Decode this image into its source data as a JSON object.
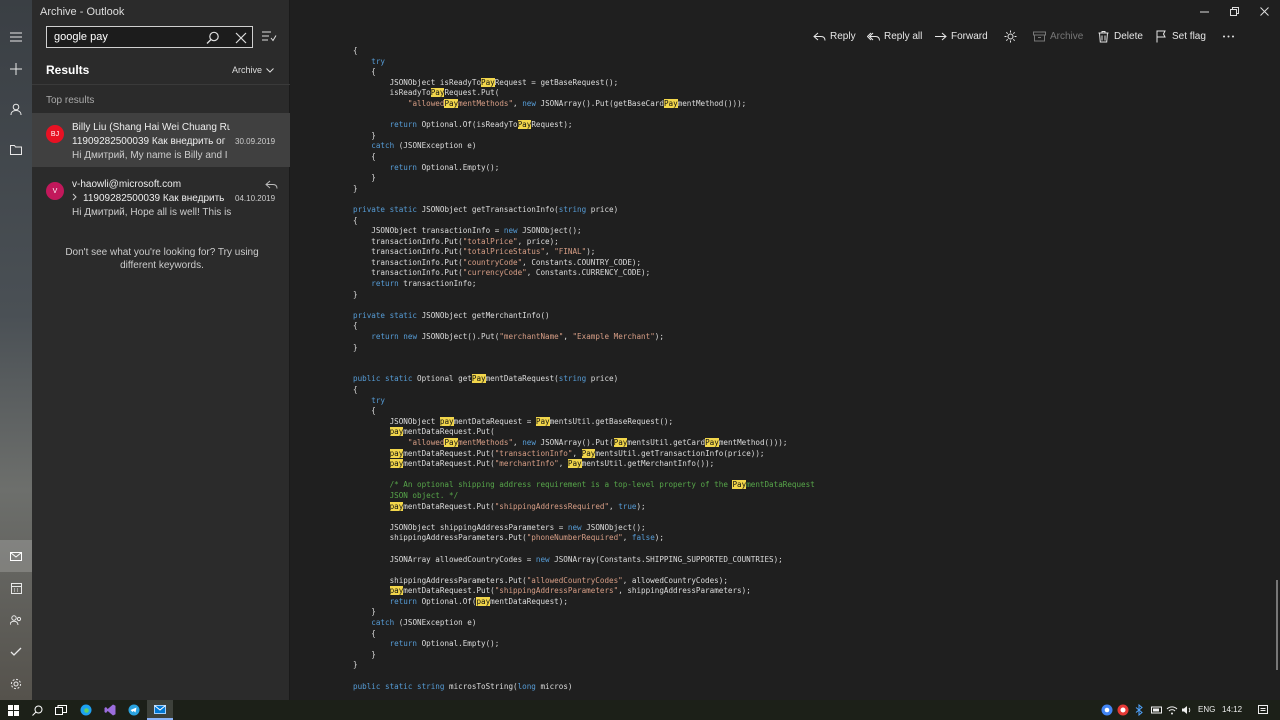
{
  "window": {
    "title": "Archive - Outlook"
  },
  "search": {
    "value": "google pay",
    "placeholder": "Search"
  },
  "list": {
    "title": "Results",
    "folder": "Archive",
    "section": "Top results",
    "empty_hint": "Don't see what you're looking for?  Try using different keywords.",
    "messages": [
      {
        "initials": "BJ",
        "avatar_color": "#e81123",
        "from": "Billy Liu (Shang Hai Wei Chuang Rua",
        "subject": "11909282500039 Как внедрить ог",
        "date": "30.09.2019",
        "preview": "Hi Дмитрий, My name is Billy and I"
      },
      {
        "initials": "V",
        "avatar_color": "#c2185b",
        "from": "v-haowli@microsoft.com",
        "subject": "11909282500039 Как внедрить",
        "date": "04.10.2019",
        "preview": "Hi Дмитрий, Hope all is well! This is"
      }
    ]
  },
  "toolbar": {
    "reply": "Reply",
    "reply_all": "Reply all",
    "forward": "Forward",
    "archive": "Archive",
    "delete": "Delete",
    "set_flag": "Set flag"
  },
  "code_lines": [
    [
      [
        "",
        "{"
      ]
    ],
    [
      [
        "kw",
        "    try"
      ]
    ],
    [
      [
        "",
        "    {"
      ]
    ],
    [
      [
        "",
        "        JSONObject isReadyTo"
      ],
      [
        "hl",
        "Pay"
      ],
      [
        "",
        "Request = getBaseRequest();"
      ]
    ],
    [
      [
        "",
        "        isReadyTo"
      ],
      [
        "hl",
        "Pay"
      ],
      [
        "",
        "Request.Put("
      ]
    ],
    [
      [
        "",
        "            "
      ],
      [
        "str",
        "\"allowed"
      ],
      [
        "hl",
        "Pay"
      ],
      [
        "str",
        "mentMethods\""
      ],
      [
        "",
        ", "
      ],
      [
        "kw",
        "new"
      ],
      [
        "",
        " JSONArray().Put(getBaseCard"
      ],
      [
        "hl",
        "Pay"
      ],
      [
        "",
        "mentMethod()));"
      ]
    ],
    [
      [
        "",
        ""
      ]
    ],
    [
      [
        "",
        "        "
      ],
      [
        "kw",
        "return"
      ],
      [
        "",
        " Optional.Of(isReadyTo"
      ],
      [
        "hl",
        "Pay"
      ],
      [
        "",
        "Request);"
      ]
    ],
    [
      [
        "",
        "    }"
      ]
    ],
    [
      [
        "kw",
        "    catch"
      ],
      [
        "",
        " (JSONException e)"
      ]
    ],
    [
      [
        "",
        "    {"
      ]
    ],
    [
      [
        "",
        "        "
      ],
      [
        "kw",
        "return"
      ],
      [
        "",
        " Optional.Empty();"
      ]
    ],
    [
      [
        "",
        "    }"
      ]
    ],
    [
      [
        "",
        "}"
      ]
    ],
    [
      [
        "",
        ""
      ]
    ],
    [
      [
        "kw",
        "private static"
      ],
      [
        "",
        " JSONObject getTransactionInfo("
      ],
      [
        "kw",
        "string"
      ],
      [
        "",
        " price)"
      ]
    ],
    [
      [
        "",
        "{"
      ]
    ],
    [
      [
        "",
        "    JSONObject transactionInfo = "
      ],
      [
        "kw",
        "new"
      ],
      [
        "",
        " JSONObject();"
      ]
    ],
    [
      [
        "",
        "    transactionInfo.Put("
      ],
      [
        "str",
        "\"totalPrice\""
      ],
      [
        "",
        ", price);"
      ]
    ],
    [
      [
        "",
        "    transactionInfo.Put("
      ],
      [
        "str",
        "\"totalPriceStatus\""
      ],
      [
        "",
        ", "
      ],
      [
        "str",
        "\"FINAL\""
      ],
      [
        "",
        ");"
      ]
    ],
    [
      [
        "",
        "    transactionInfo.Put("
      ],
      [
        "str",
        "\"countryCode\""
      ],
      [
        "",
        ", Constants.COUNTRY_CODE);"
      ]
    ],
    [
      [
        "",
        "    transactionInfo.Put("
      ],
      [
        "str",
        "\"currencyCode\""
      ],
      [
        "",
        ", Constants.CURRENCY_CODE);"
      ]
    ],
    [
      [
        "",
        "    "
      ],
      [
        "kw",
        "return"
      ],
      [
        "",
        " transactionInfo;"
      ]
    ],
    [
      [
        "",
        "}"
      ]
    ],
    [
      [
        "",
        ""
      ]
    ],
    [
      [
        "kw",
        "private static"
      ],
      [
        "",
        " JSONObject getMerchantInfo()"
      ]
    ],
    [
      [
        "",
        "{"
      ]
    ],
    [
      [
        "",
        "    "
      ],
      [
        "kw",
        "return new"
      ],
      [
        "",
        " JSONObject().Put("
      ],
      [
        "str",
        "\"merchantName\""
      ],
      [
        "",
        ", "
      ],
      [
        "str",
        "\"Example Merchant\""
      ],
      [
        "",
        ");"
      ]
    ],
    [
      [
        "",
        "}"
      ]
    ],
    [
      [
        "",
        ""
      ]
    ],
    [
      [
        "",
        ""
      ]
    ],
    [
      [
        "kw",
        "public static"
      ],
      [
        "",
        " Optional get"
      ],
      [
        "hl",
        "Pay"
      ],
      [
        "",
        "mentDataRequest("
      ],
      [
        "kw",
        "string"
      ],
      [
        "",
        " price)"
      ]
    ],
    [
      [
        "",
        "{"
      ]
    ],
    [
      [
        "kw",
        "    try"
      ]
    ],
    [
      [
        "",
        "    {"
      ]
    ],
    [
      [
        "",
        "        JSONObject "
      ],
      [
        "hl",
        "pay"
      ],
      [
        "",
        "mentDataRequest = "
      ],
      [
        "hl",
        "Pay"
      ],
      [
        "",
        "mentsUtil.getBaseRequest();"
      ]
    ],
    [
      [
        "",
        "        "
      ],
      [
        "hl",
        "pay"
      ],
      [
        "",
        "mentDataRequest.Put("
      ]
    ],
    [
      [
        "",
        "            "
      ],
      [
        "str",
        "\"allowed"
      ],
      [
        "hl",
        "Pay"
      ],
      [
        "str",
        "mentMethods\""
      ],
      [
        "",
        ", "
      ],
      [
        "kw",
        "new"
      ],
      [
        "",
        " JSONArray().Put("
      ],
      [
        "hl",
        "Pay"
      ],
      [
        "",
        "mentsUtil.getCard"
      ],
      [
        "hl",
        "Pay"
      ],
      [
        "",
        "mentMethod()));"
      ]
    ],
    [
      [
        "",
        "        "
      ],
      [
        "hl",
        "pay"
      ],
      [
        "",
        "mentDataRequest.Put("
      ],
      [
        "str",
        "\"transactionInfo\""
      ],
      [
        "",
        ", "
      ],
      [
        "hl",
        "Pay"
      ],
      [
        "",
        "mentsUtil.getTransactionInfo(price));"
      ]
    ],
    [
      [
        "",
        "        "
      ],
      [
        "hl",
        "pay"
      ],
      [
        "",
        "mentDataRequest.Put("
      ],
      [
        "str",
        "\"merchantInfo\""
      ],
      [
        "",
        ", "
      ],
      [
        "hl",
        "Pay"
      ],
      [
        "",
        "mentsUtil.getMerchantInfo());"
      ]
    ],
    [
      [
        "",
        ""
      ]
    ],
    [
      [
        "cm",
        "        /* An optional shipping address requirement is a top-level property of the "
      ],
      [
        "hl",
        "Pay"
      ],
      [
        "cm",
        "mentDataRequest"
      ]
    ],
    [
      [
        "cm",
        "        JSON object. */"
      ]
    ],
    [
      [
        "",
        "        "
      ],
      [
        "hl",
        "pay"
      ],
      [
        "",
        "mentDataRequest.Put("
      ],
      [
        "str",
        "\"shippingAddressRequired\""
      ],
      [
        "",
        ", "
      ],
      [
        "kw",
        "true"
      ],
      [
        "",
        ");"
      ]
    ],
    [
      [
        "",
        ""
      ]
    ],
    [
      [
        "",
        "        JSONObject shippingAddressParameters = "
      ],
      [
        "kw",
        "new"
      ],
      [
        "",
        " JSONObject();"
      ]
    ],
    [
      [
        "",
        "        shippingAddressParameters.Put("
      ],
      [
        "str",
        "\"phoneNumberRequired\""
      ],
      [
        "",
        ", "
      ],
      [
        "kw",
        "false"
      ],
      [
        "",
        ");"
      ]
    ],
    [
      [
        "",
        ""
      ]
    ],
    [
      [
        "",
        "        JSONArray allowedCountryCodes = "
      ],
      [
        "kw",
        "new"
      ],
      [
        "",
        " JSONArray(Constants.SHIPPING_SUPPORTED_COUNTRIES);"
      ]
    ],
    [
      [
        "",
        ""
      ]
    ],
    [
      [
        "",
        "        shippingAddressParameters.Put("
      ],
      [
        "str",
        "\"allowedCountryCodes\""
      ],
      [
        "",
        ", allowedCountryCodes);"
      ]
    ],
    [
      [
        "",
        "        "
      ],
      [
        "hl",
        "pay"
      ],
      [
        "",
        "mentDataRequest.Put("
      ],
      [
        "str",
        "\"shippingAddressParameters\""
      ],
      [
        "",
        ", shippingAddressParameters);"
      ]
    ],
    [
      [
        "",
        "        "
      ],
      [
        "kw",
        "return"
      ],
      [
        "",
        " Optional.Of("
      ],
      [
        "hl",
        "pay"
      ],
      [
        "",
        "mentDataRequest);"
      ]
    ],
    [
      [
        "",
        "    }"
      ]
    ],
    [
      [
        "kw",
        "    catch"
      ],
      [
        "",
        " (JSONException e)"
      ]
    ],
    [
      [
        "",
        "    {"
      ]
    ],
    [
      [
        "",
        "        "
      ],
      [
        "kw",
        "return"
      ],
      [
        "",
        " Optional.Empty();"
      ]
    ],
    [
      [
        "",
        "    }"
      ]
    ],
    [
      [
        "",
        "}"
      ]
    ],
    [
      [
        "",
        ""
      ]
    ],
    [
      [
        "kw",
        "public static string"
      ],
      [
        "",
        " microsToString("
      ],
      [
        "kw",
        "long"
      ],
      [
        "",
        " micros)"
      ]
    ]
  ],
  "taskbar": {
    "lang": "ENG",
    "time": "14:12"
  },
  "colors": {
    "accent": "#0078d4",
    "highlight": "#f2d64b",
    "keyword": "#569cd6",
    "string": "#d69d85",
    "comment": "#57a64a"
  }
}
